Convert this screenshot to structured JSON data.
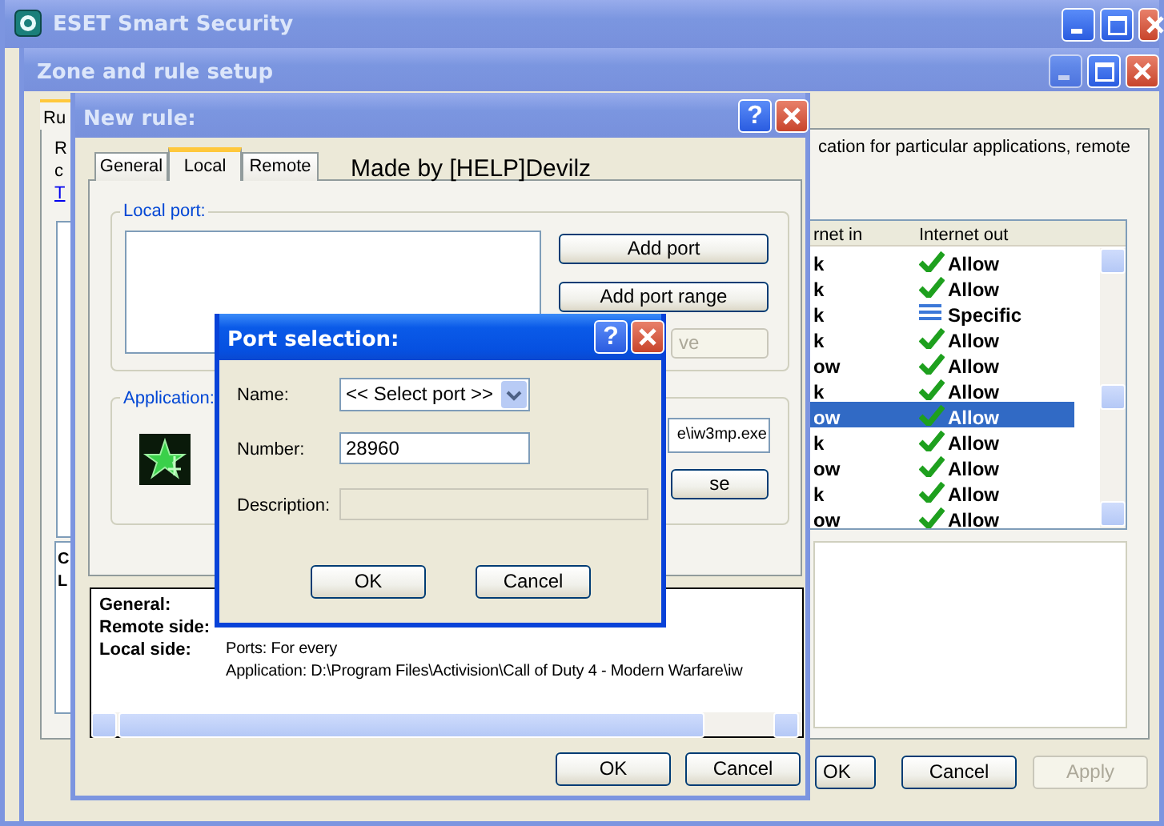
{
  "main_window": {
    "title": "ESET Smart Security"
  },
  "zone_window": {
    "title": "Zone and rule setup",
    "tab": "Ru",
    "intro_start": [
      "R",
      "c"
    ],
    "link": "T",
    "intro_end": "cation for particular applications, remote",
    "table": {
      "columns": [
        "rnet in",
        "Internet out"
      ],
      "rows": [
        {
          "internet_in": "k",
          "internet_out": "Allow",
          "kind": "allow",
          "selected": false
        },
        {
          "internet_in": "k",
          "internet_out": "Allow",
          "kind": "allow",
          "selected": false
        },
        {
          "internet_in": "k",
          "internet_out": "Specific",
          "kind": "specific",
          "selected": false
        },
        {
          "internet_in": "k",
          "internet_out": "Allow",
          "kind": "allow",
          "selected": false
        },
        {
          "internet_in": "ow",
          "internet_out": "Allow",
          "kind": "allow",
          "selected": false
        },
        {
          "internet_in": "k",
          "internet_out": "Allow",
          "kind": "allow",
          "selected": false
        },
        {
          "internet_in": "ow",
          "internet_out": "Allow",
          "kind": "allow",
          "selected": true
        },
        {
          "internet_in": "k",
          "internet_out": "Allow",
          "kind": "allow",
          "selected": false
        },
        {
          "internet_in": "ow",
          "internet_out": "Allow",
          "kind": "allow",
          "selected": false
        },
        {
          "internet_in": "k",
          "internet_out": "Allow",
          "kind": "allow",
          "selected": false
        },
        {
          "internet_in": "ow",
          "internet_out": "Allow",
          "kind": "allow",
          "selected": false
        }
      ]
    },
    "list_letters": [
      "C",
      "L"
    ],
    "buttons": [
      {
        "label": "OK",
        "disabled": false
      },
      {
        "label": "Cancel",
        "disabled": false
      },
      {
        "label": "Apply",
        "disabled": true
      }
    ]
  },
  "new_rule_window": {
    "title": "New rule:",
    "help": "?",
    "tabs": [
      {
        "label": "General",
        "selected": false
      },
      {
        "label": "Local",
        "selected": true
      },
      {
        "label": "Remote",
        "selected": false
      }
    ],
    "credit": "Made by [HELP]Devilz",
    "local_port": {
      "label": "Local port:",
      "buttons": [
        {
          "label": "Add port",
          "disabled": false
        },
        {
          "label": "Add port range",
          "disabled": false
        },
        {
          "label": "ve",
          "disabled": true
        }
      ]
    },
    "application": {
      "label": "Application:",
      "path": "e\\iw3mp.exe",
      "button": "se"
    },
    "summary": [
      {
        "label": "General:"
      },
      {
        "label": "Remote side:"
      },
      {
        "label": "Local side:",
        "lines": [
          "Ports: For every",
          "Application: D:\\Program Files\\Activision\\Call of Duty 4 - Modern Warfare\\iw"
        ]
      }
    ],
    "buttons": [
      {
        "label": "OK",
        "disabled": false
      },
      {
        "label": "Cancel",
        "disabled": false
      }
    ]
  },
  "port_dialog": {
    "title": "Port selection:",
    "help": "?",
    "fields": [
      {
        "label": "Name:",
        "kind": "select",
        "value": "<< Select port >>",
        "disabled": false
      },
      {
        "label": "Number:",
        "kind": "text",
        "value": "28960",
        "disabled": false
      },
      {
        "label": "Description:",
        "kind": "text",
        "disabled": true
      }
    ],
    "buttons": [
      {
        "label": "OK",
        "disabled": false
      },
      {
        "label": "Cancel",
        "disabled": false
      }
    ]
  }
}
